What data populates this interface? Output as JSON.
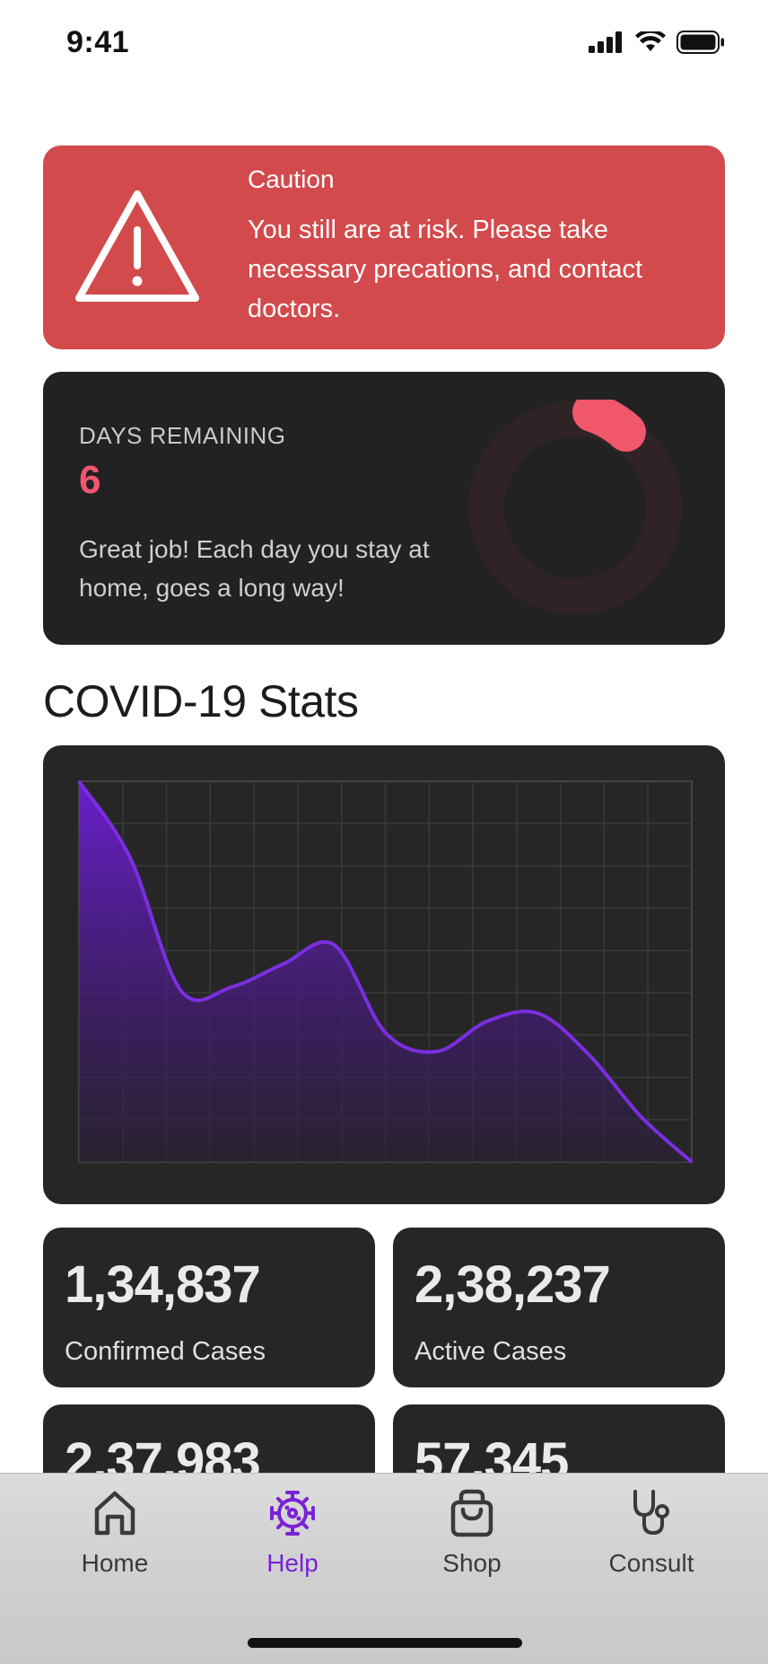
{
  "status_bar": {
    "time": "9:41"
  },
  "caution": {
    "title": "Caution",
    "message": "You still are at risk. Please take necessary precations, and contact doctors.",
    "color": "#d24a4c"
  },
  "days_remaining": {
    "label": "DAYS REMAINING",
    "count": "6",
    "message": "Great job! Each day you stay at home, goes a long way!",
    "accent": "#f0566c"
  },
  "stats_section": {
    "title": "COVID-19 Stats",
    "chart_data": {
      "type": "area",
      "title": "",
      "xlabel": "",
      "ylabel": "",
      "grid": true,
      "color": "#7b2ee0",
      "points": [
        [
          0,
          1.0
        ],
        [
          1,
          0.8
        ],
        [
          2,
          0.45
        ],
        [
          3,
          0.46
        ],
        [
          4,
          0.52
        ],
        [
          5,
          0.57
        ],
        [
          6,
          0.34
        ],
        [
          7,
          0.29
        ],
        [
          8,
          0.37
        ],
        [
          9,
          0.39
        ],
        [
          10,
          0.28
        ],
        [
          11,
          0.12
        ],
        [
          12,
          0.0
        ]
      ]
    },
    "cards": [
      {
        "value": "1,34,837",
        "label": "Confirmed Cases"
      },
      {
        "value": "2,38,237",
        "label": "Active Cases"
      },
      {
        "value": "2,37,983",
        "label": ""
      },
      {
        "value": "57,345",
        "label": ""
      }
    ]
  },
  "tab_bar": {
    "active": "Help",
    "active_color": "#7a22d6",
    "items": [
      {
        "label": "Home",
        "icon": "home-icon"
      },
      {
        "label": "Help",
        "icon": "virus-icon"
      },
      {
        "label": "Shop",
        "icon": "shopping-bag-icon"
      },
      {
        "label": "Consult",
        "icon": "stethoscope-icon"
      }
    ]
  }
}
